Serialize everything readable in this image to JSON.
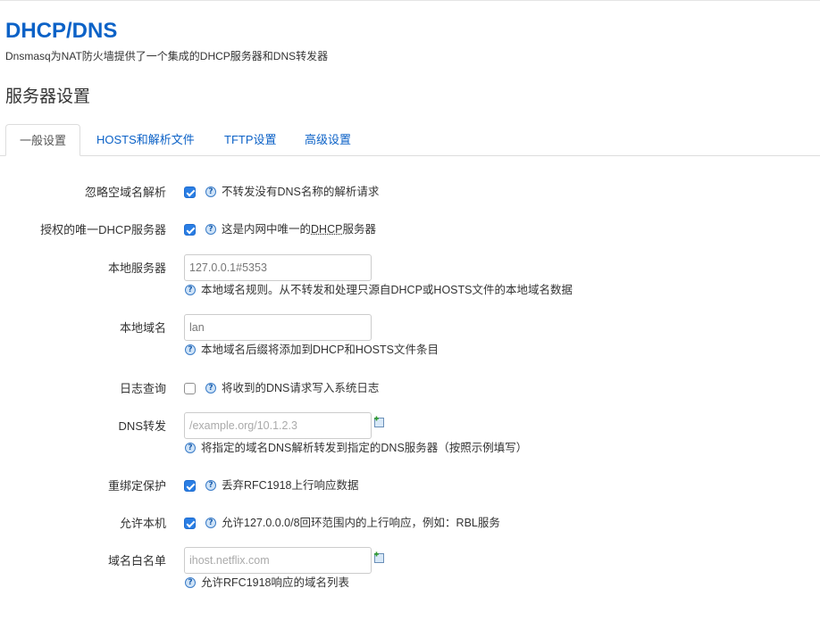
{
  "header": {
    "title": "DHCP/DNS",
    "description": "Dnsmasq为NAT防火墙提供了一个集成的DHCP服务器和DNS转发器"
  },
  "section": {
    "title": "服务器设置"
  },
  "tabs": [
    {
      "label": "一般设置",
      "active": true
    },
    {
      "label": "HOSTS和解析文件",
      "active": false
    },
    {
      "label": "TFTP设置",
      "active": false
    },
    {
      "label": "高级设置",
      "active": false
    }
  ],
  "fields": {
    "domainneeded": {
      "label": "忽略空域名解析",
      "checked": true,
      "help": "不转发没有DNS名称的解析请求"
    },
    "authoritative": {
      "label": "授权的唯一DHCP服务器",
      "checked": true,
      "help_prefix": "这是内网中唯一的",
      "help_abbr": "DHCP",
      "help_suffix": "服务器"
    },
    "local": {
      "label": "本地服务器",
      "value": "127.0.0.1#5353",
      "help": "本地域名规则。从不转发和处理只源自DHCP或HOSTS文件的本地域名数据"
    },
    "domain": {
      "label": "本地域名",
      "value": "lan",
      "help": "本地域名后缀将添加到DHCP和HOSTS文件条目"
    },
    "logqueries": {
      "label": "日志查询",
      "checked": false,
      "help": "将收到的DNS请求写入系统日志"
    },
    "server": {
      "label": "DNS转发",
      "placeholder": "/example.org/10.1.2.3",
      "help": "将指定的域名DNS解析转发到指定的DNS服务器（按照示例填写）"
    },
    "rebind_protection": {
      "label": "重绑定保护",
      "checked": true,
      "help": "丢弃RFC1918上行响应数据"
    },
    "rebind_localhost": {
      "label": "允许本机",
      "checked": true,
      "help": "允许127.0.0.0/8回环范围内的上行响应，例如：RBL服务"
    },
    "rebind_domain": {
      "label": "域名白名单",
      "placeholder": "ihost.netflix.com",
      "help": "允许RFC1918响应的域名列表"
    }
  },
  "icons": {
    "help": "question-circle-icon",
    "add": "add-entry-icon"
  },
  "colors": {
    "accent": "#0c62c7",
    "checkbox": "#2a7ee4"
  }
}
